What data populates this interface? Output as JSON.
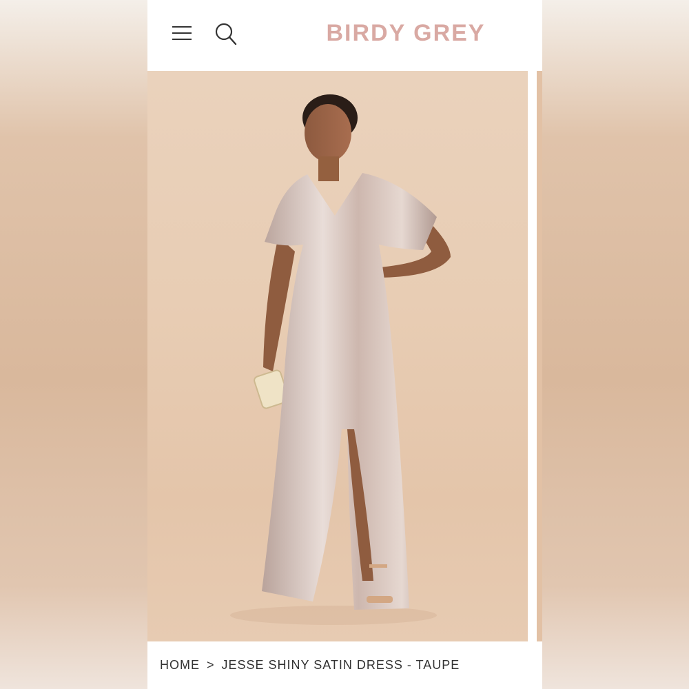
{
  "header": {
    "logo": "BIRDY GREY",
    "menu_icon": "hamburger-menu-icon",
    "search_icon": "search-icon"
  },
  "hero": {
    "image_subject": "model-in-satin-dress",
    "colors": {
      "background": "#e8cdb4",
      "dress": "#d7c3bb"
    }
  },
  "breadcrumb": {
    "home": "HOME",
    "separator": ">",
    "current": "JESSE SHINY SATIN DRESS - TAUPE"
  },
  "colors": {
    "brand": "#d9a9a3",
    "text": "#333333"
  }
}
